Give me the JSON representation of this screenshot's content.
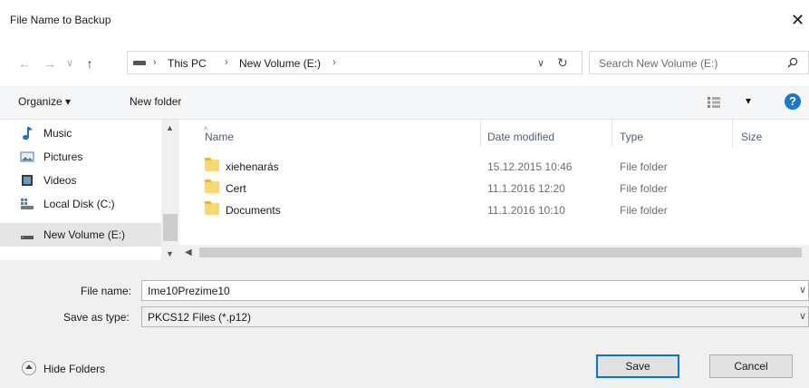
{
  "window": {
    "title": "File Name to Backup"
  },
  "nav": {
    "back": "←",
    "forward": "→",
    "recent": "∨",
    "up": "↑",
    "breadcrumb": [
      "This PC",
      "New Volume (E:)"
    ],
    "sep": "›",
    "dropdown": "∨",
    "refresh": "↻",
    "search_placeholder": "Search New Volume (E:)"
  },
  "toolbar": {
    "organize": "Organize ▾",
    "new_folder": "New folder",
    "view": "▾",
    "help": "?"
  },
  "sidebar": {
    "items": [
      {
        "label": "Music",
        "icon": "music-icon",
        "selected": false
      },
      {
        "label": "Pictures",
        "icon": "pictures-icon",
        "selected": false
      },
      {
        "label": "Videos",
        "icon": "videos-icon",
        "selected": false
      },
      {
        "label": "Local Disk (C:)",
        "icon": "local-disk-icon",
        "selected": false
      },
      {
        "label": "New Volume (E:)",
        "icon": "drive-icon",
        "selected": true
      }
    ]
  },
  "files": {
    "columns": [
      "Name",
      "Date modified",
      "Type",
      "Size"
    ],
    "rows": [
      {
        "name": "xiehenarás",
        "date": "15.12.2015 10:46",
        "type": "File folder",
        "size": ""
      },
      {
        "name": "Cert",
        "date": "11.1.2016 12:20",
        "type": "File folder",
        "size": ""
      },
      {
        "name": "Documents",
        "date": "11.1.2016 10:10",
        "type": "File folder",
        "size": ""
      }
    ]
  },
  "form": {
    "file_name_label": "File name:",
    "file_name_value": "Ime10Prezime10",
    "save_type_label": "Save as type:",
    "save_type_value": "PKCS12 Files (*.p12)"
  },
  "buttons": {
    "hide_folders": "Hide Folders",
    "save": "Save",
    "cancel": "Cancel"
  },
  "colors": {
    "accent": "#0078d7",
    "help": "#1979ca",
    "header_text": "#4c607a",
    "folder": "#f8d775"
  }
}
